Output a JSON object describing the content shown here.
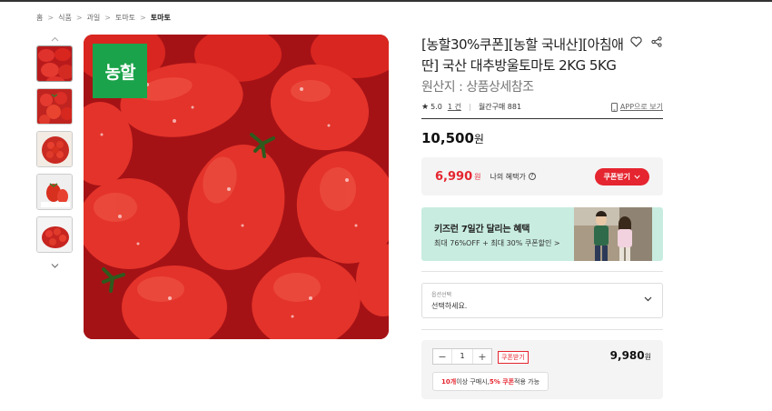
{
  "breadcrumb": [
    "홈",
    "식품",
    "과일",
    "토마토",
    "토마토"
  ],
  "thumbnails": {
    "count": 5
  },
  "brand_badge": "농할",
  "product": {
    "title": "[농할30%쿠폰][농할 국내산][아침애딴] 국산 대추방울토마토 2KG 5KG",
    "origin": "원산지 : 상품상세참조",
    "rating": "5.0",
    "review_count": "1 건",
    "monthly_purchase": "월간구매 881",
    "app_link": "APP으로 보기",
    "price": "10,500",
    "currency": "원"
  },
  "benefit": {
    "price": "6,990",
    "currency": "원",
    "label": "나의 혜택가",
    "info_mark": "?",
    "coupon_button": "쿠폰받기"
  },
  "banner": {
    "title": "키즈런 7일간 달리는 혜택",
    "subtitle": "최대 76%OFF + 최대 30% 쿠폰할인 >"
  },
  "option_select": {
    "label": "옵션선택",
    "placeholder": "선택하세요."
  },
  "order": {
    "minus": "−",
    "quantity": "1",
    "plus": "+",
    "coupon_tag": "쿠폰받기",
    "price": "9,980",
    "currency": "원",
    "bulk_count": "10개",
    "bulk_mid": " 이상 구매시, ",
    "bulk_discount": "5% 쿠폰",
    "bulk_end": " 적용 가능"
  },
  "colors": {
    "accent": "#e5252f",
    "brand_green": "#1aa34a",
    "banner_bg": "#c8ece0"
  }
}
